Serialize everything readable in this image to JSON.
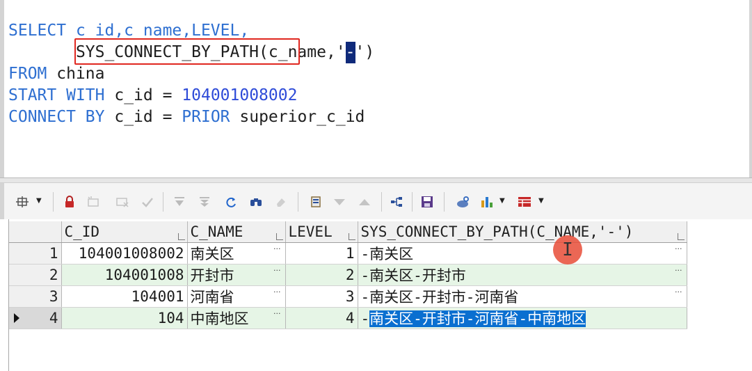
{
  "editor": {
    "line1": {
      "kw1": "SELECT",
      "rest1": " c_id,c_name,",
      "kw2": "LEVEL",
      "rest2": ","
    },
    "line2": {
      "indent": "       ",
      "func": "SYS_CONNECT_BY_PATH",
      "args_pre": "(c_name,'",
      "sep_char": "-",
      "args_post": "')"
    },
    "line3": {
      "kw": "FROM",
      "rest": " china"
    },
    "line4": {
      "kw1": "START",
      "kw2": "WITH",
      "rest": " c_id = ",
      "num": "104001008002"
    },
    "line5": {
      "kw1": "CONNECT",
      "kw2": "BY",
      "rest": " c_id = ",
      "kw3": "PRIOR",
      "rest2": " superior_c_id"
    }
  },
  "toolbar": {
    "icons": [
      "grid-options-icon",
      "lock-icon",
      "insert-record-icon",
      "delete-record-icon",
      "post-changes-icon",
      "fetch-next-icon",
      "fetch-all-icon",
      "refresh-icon",
      "find-icon",
      "clear-icon",
      "single-record-icon",
      "filter-down-icon",
      "filter-up-icon",
      "query-tree-icon",
      "save-icon",
      "print-icon",
      "chart-icon",
      "export-icon"
    ]
  },
  "grid": {
    "columns": [
      "C_ID",
      "C_NAME",
      "LEVEL",
      "SYS_CONNECT_BY_PATH(C_NAME,'-')"
    ],
    "rows": [
      {
        "num": "1",
        "c_id": "104001008002",
        "c_name": "南关区",
        "level": "1",
        "path_pre": "-南关区",
        "path_sel": ""
      },
      {
        "num": "2",
        "c_id": "104001008",
        "c_name": "开封市",
        "level": "2",
        "path_pre": "-南关区-开封市",
        "path_sel": ""
      },
      {
        "num": "3",
        "c_id": "104001",
        "c_name": "河南省",
        "level": "3",
        "path_pre": "-南关区-开封市-河南省",
        "path_sel": ""
      },
      {
        "num": "4",
        "c_id": "104",
        "c_name": "中南地区",
        "level": "4",
        "path_pre": "-",
        "path_sel": "南关区-开封市-河南省-中南地区"
      }
    ],
    "ellipsis": "···"
  },
  "cursor": {
    "glyph": "I"
  },
  "colors": {
    "keyword": "#2e6fd1",
    "number": "#2e4bd8",
    "highlight_box": "#e0271f",
    "row_alt": "#e6f5e6",
    "selection": "#0a6fd0"
  }
}
